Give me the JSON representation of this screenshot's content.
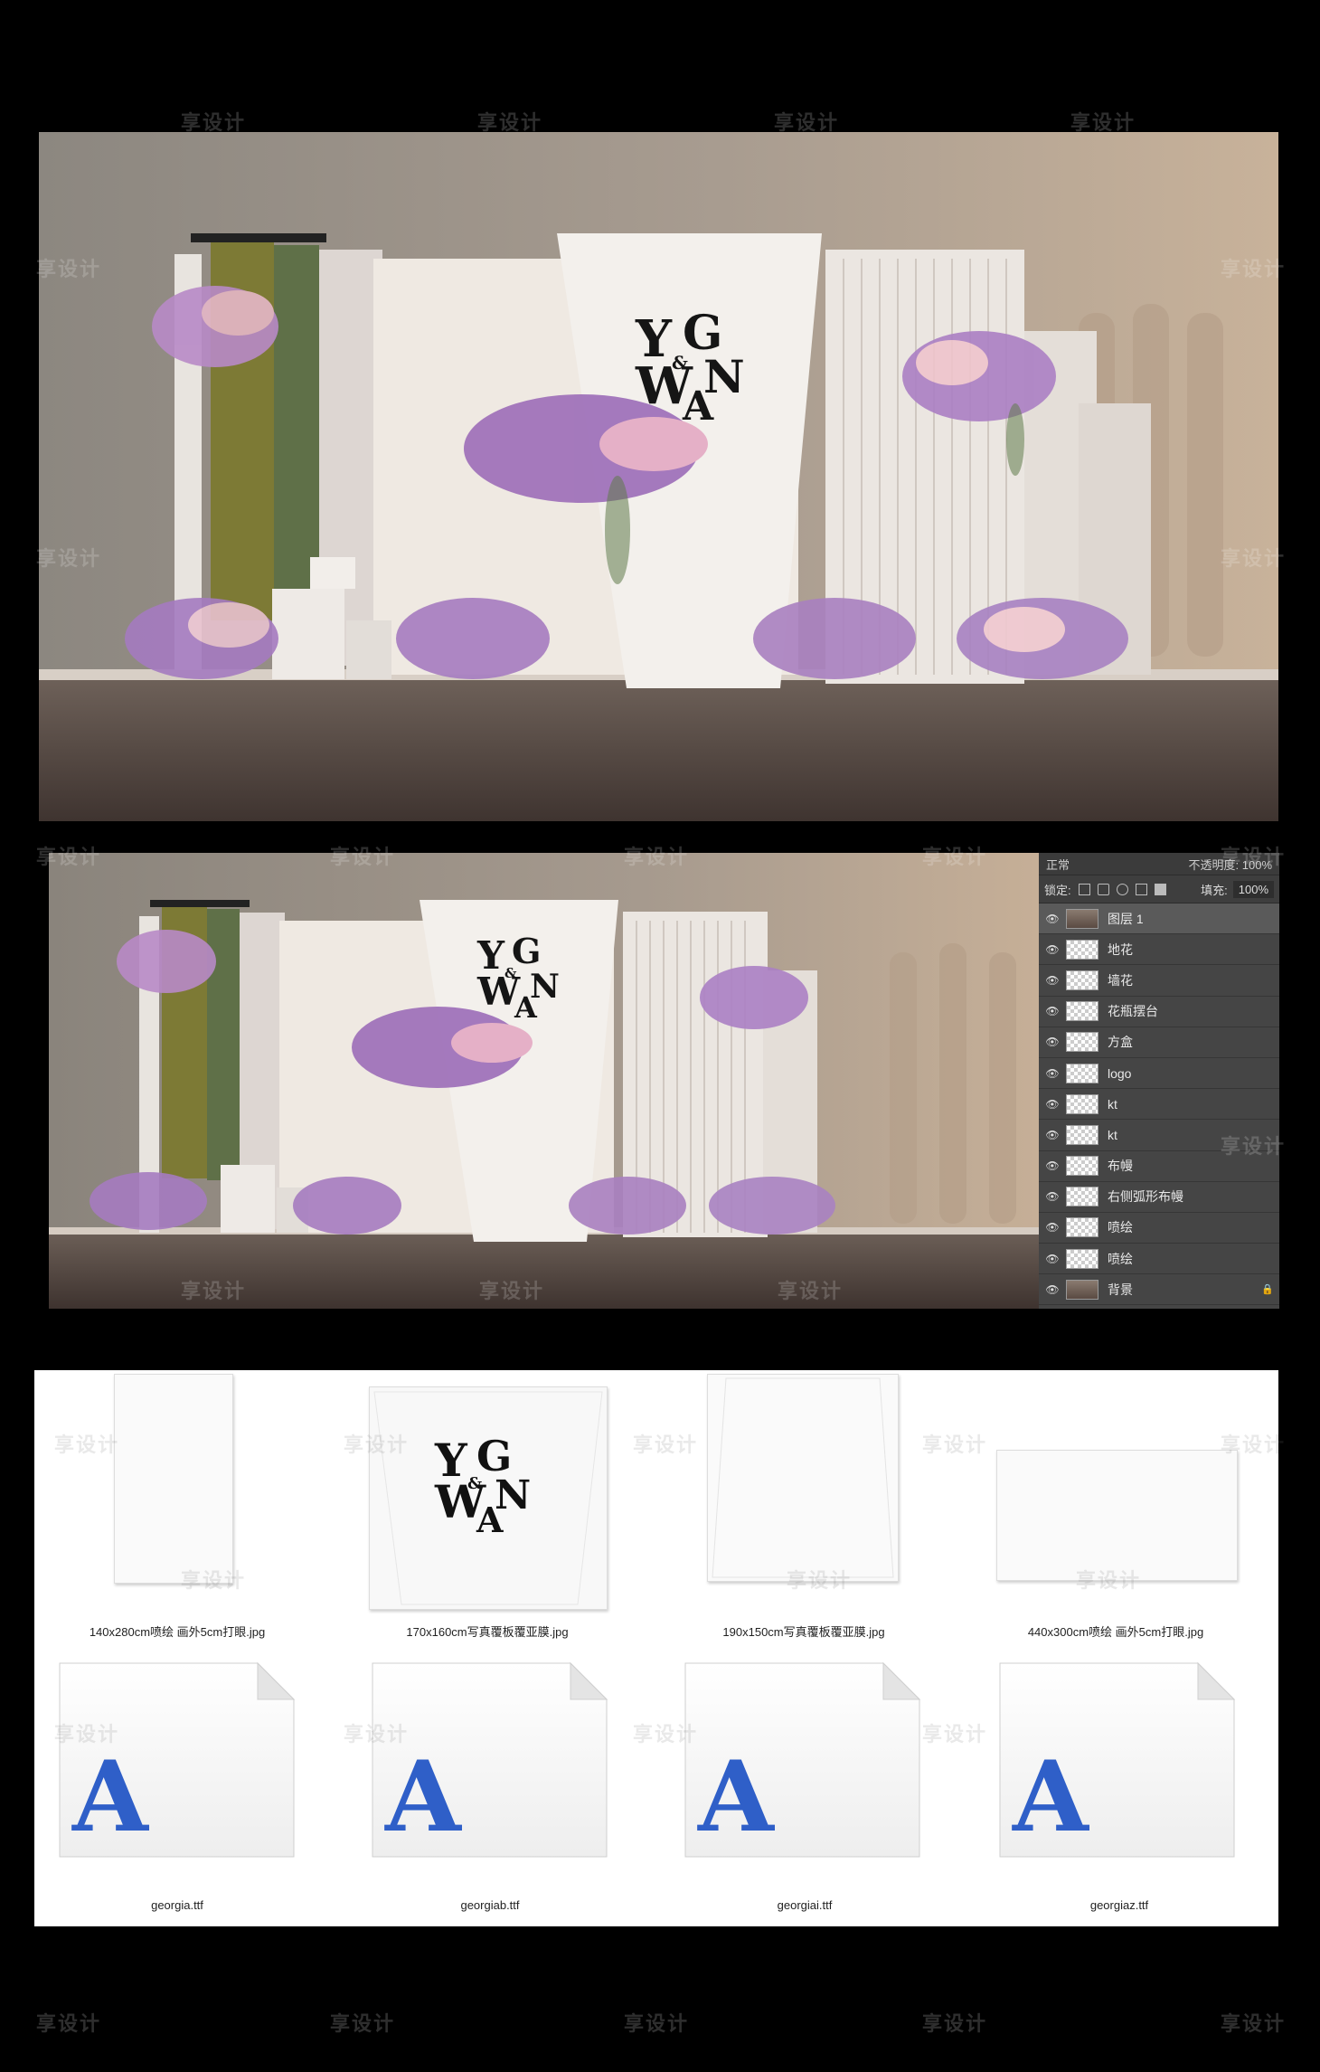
{
  "watermark_text": "享设计",
  "render_top": {
    "monogram": [
      "Y",
      "G",
      "&",
      "W",
      "N",
      "A"
    ]
  },
  "render_mid": {
    "monogram": [
      "Y",
      "G",
      "&",
      "W",
      "N",
      "A"
    ]
  },
  "layers_panel": {
    "blend_mode": "正常",
    "opacity_label": "不透明度:",
    "opacity_value": "100%",
    "lock_label": "锁定:",
    "fill_label": "填充:",
    "fill_value": "100%",
    "layers": [
      {
        "name": "图层 1",
        "selected": true
      },
      {
        "name": "地花"
      },
      {
        "name": "墙花"
      },
      {
        "name": "花瓶摆台"
      },
      {
        "name": "方盒"
      },
      {
        "name": "logo"
      },
      {
        "name": "kt"
      },
      {
        "name": "kt"
      },
      {
        "name": "布幔"
      },
      {
        "name": "右侧弧形布幔"
      },
      {
        "name": "喷绘"
      },
      {
        "name": "喷绘"
      },
      {
        "name": "背景",
        "locked": true
      }
    ]
  },
  "files": {
    "images": [
      {
        "caption": "140x280cm喷绘 画外5cm打眼.jpg"
      },
      {
        "caption": "170x160cm写真覆板覆亚膜.jpg"
      },
      {
        "caption": "190x150cm写真覆板覆亚膜.jpg"
      },
      {
        "caption": "440x300cm喷绘 画外5cm打眼.jpg"
      }
    ],
    "fonts": [
      {
        "caption": "georgia.ttf",
        "letter": "A"
      },
      {
        "caption": "georgiab.ttf",
        "letter": "A"
      },
      {
        "caption": "georgiai.ttf",
        "letter": "A"
      },
      {
        "caption": "georgiaz.ttf",
        "letter": "A"
      }
    ],
    "accent_color": "#2f5fc8"
  }
}
